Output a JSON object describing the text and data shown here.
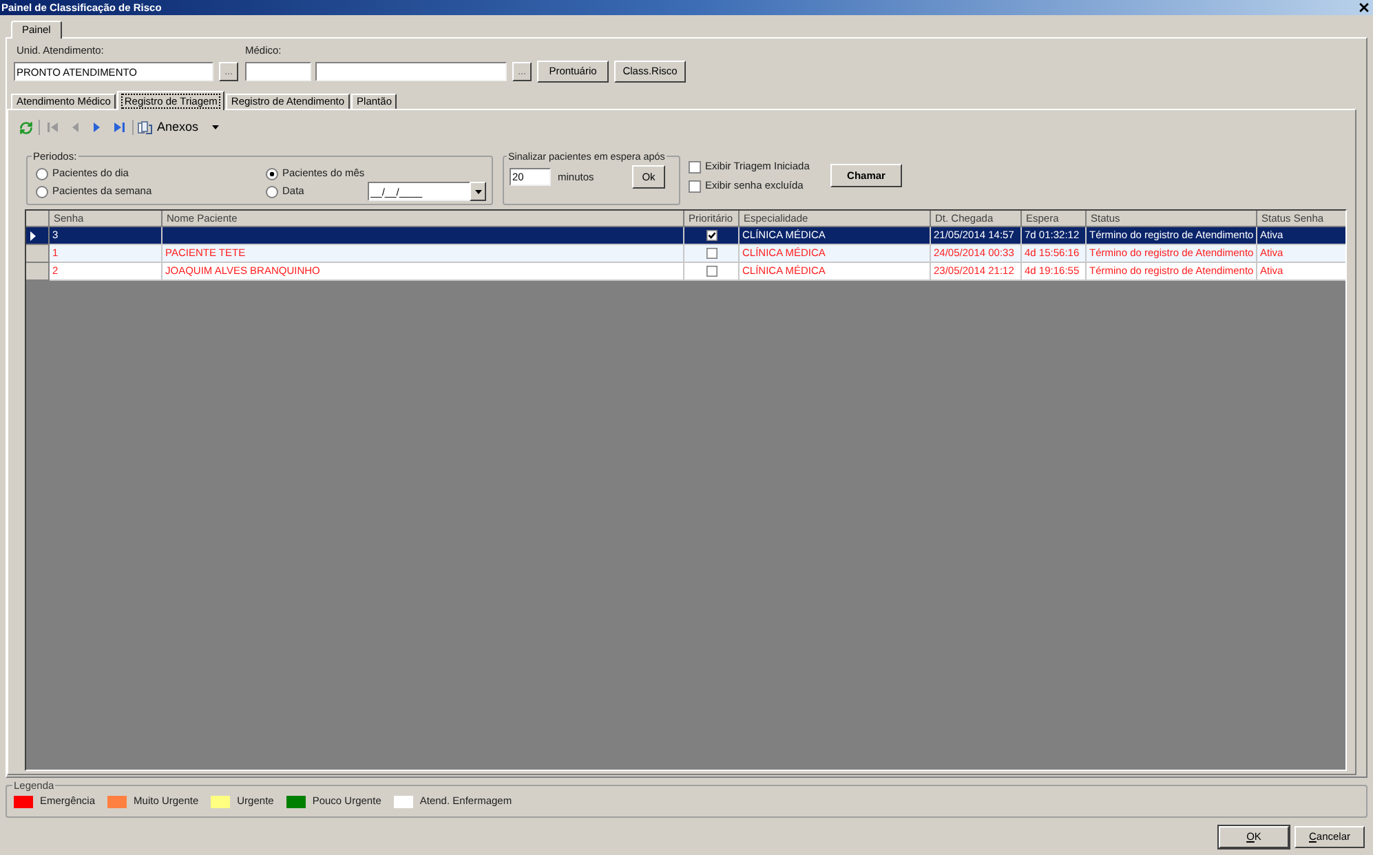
{
  "window": {
    "title": "Painel de Classificação de Risco"
  },
  "outer_tabs": [
    {
      "label": "Painel",
      "selected": true
    }
  ],
  "unit": {
    "label": "Unid. Atendimento:",
    "value": "PRONTO ATENDIMENTO",
    "browse": "..."
  },
  "doctor": {
    "label": "Médico:",
    "browse": "..."
  },
  "actions": [
    "Prontuário",
    "Class.Risco"
  ],
  "tabs": [
    {
      "label": "Atendimento Médico",
      "selected": false
    },
    {
      "label": "Registro de Triagem",
      "selected": true
    },
    {
      "label": "Registro de Atendimento",
      "selected": false
    },
    {
      "label": "Plantão",
      "selected": false
    }
  ],
  "toolbar": {
    "nav": [
      {
        "kind": "first",
        "disabled": true
      },
      {
        "kind": "previous",
        "disabled": true
      },
      {
        "kind": "next",
        "disabled": false
      },
      {
        "kind": "last",
        "disabled": false
      }
    ],
    "attachments": "Anexos"
  },
  "periods": {
    "title": "Periodos:",
    "options": [
      {
        "label": "Pacientes do dia",
        "selected": false
      },
      {
        "label": "Pacientes do mês",
        "selected": true
      },
      {
        "label": "Pacientes da semana",
        "selected": false
      },
      {
        "label": "Data",
        "selected": false
      }
    ],
    "date": "__/__/____"
  },
  "wait_alert": {
    "title": "Sinalizar pacientes em espera após",
    "value": "20",
    "unit": "minutos",
    "button": "Ok"
  },
  "filters": [
    {
      "label": "Exibir Triagem Iniciada",
      "checked": false
    },
    {
      "label": "Exibir senha excluída",
      "checked": false
    }
  ],
  "call_button": "Chamar",
  "table": {
    "columns": [
      "Senha",
      "Nome Paciente",
      "Prioritário",
      "Especialidade",
      "Dt. Chegada",
      "Espera",
      "Status",
      "Status Senha"
    ],
    "rows": [
      {
        "selected": true,
        "senha": "3",
        "prioritario": true,
        "especialidade": "CLÍNICA MÉDICA",
        "dt_chegada": "21/05/2014 14:57",
        "espera": "7d 01:32:12",
        "status": "Término do registro de Atendimento",
        "status_senha": "Ativa"
      },
      {
        "selected": false,
        "color": "#ff2020",
        "senha": "1",
        "nome": "PACIENTE TETE",
        "prioritario": false,
        "especialidade": "CLÍNICA MÉDICA",
        "dt_chegada": "24/05/2014 00:33",
        "espera": "4d 15:56:16",
        "status": "Término do registro de Atendimento",
        "status_senha": "Ativa"
      },
      {
        "selected": false,
        "color": "#ff2020",
        "senha": "2",
        "nome": "JOAQUIM ALVES BRANQUINHO",
        "prioritario": false,
        "especialidade": "CLÍNICA MÉDICA",
        "dt_chegada": "23/05/2014 21:12",
        "espera": "4d 19:16:55",
        "status": "Término do registro de Atendimento",
        "status_senha": "Ativa"
      }
    ]
  },
  "legend": {
    "title": "Legenda",
    "items": [
      {
        "label": "Emergência",
        "color": "#ff0000"
      },
      {
        "label": "Muito Urgente",
        "color": "#ff8040"
      },
      {
        "label": "Urgente",
        "color": "#ffff80"
      },
      {
        "label": "Pouco Urgente",
        "color": "#008000"
      },
      {
        "label": "Atend. Enfermagem",
        "color": "#ffffff"
      }
    ]
  },
  "buttons": [
    "OK",
    "Cancelar"
  ]
}
